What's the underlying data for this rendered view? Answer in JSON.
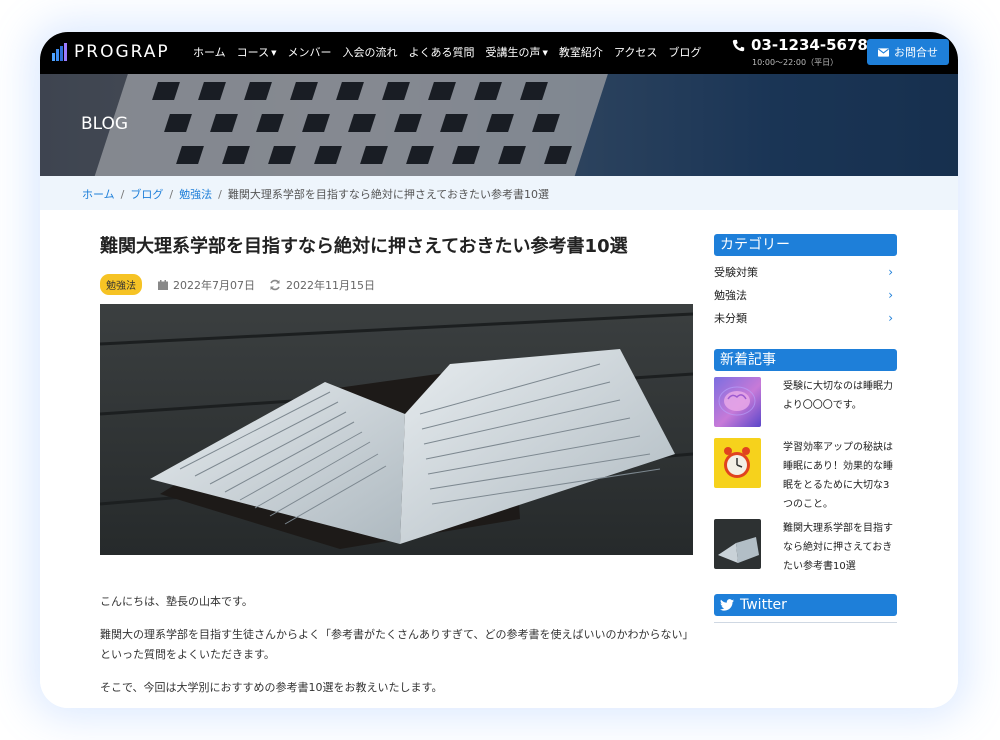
{
  "header": {
    "logo_text": "PROGRAP",
    "nav": [
      {
        "label": "ホーム",
        "has_caret": false
      },
      {
        "label": "コース",
        "has_caret": true
      },
      {
        "label": "メンバー",
        "has_caret": false
      },
      {
        "label": "入会の流れ",
        "has_caret": false
      },
      {
        "label": "よくある質問",
        "has_caret": false
      },
      {
        "label": "受講生の声",
        "has_caret": true
      },
      {
        "label": "教室紹介",
        "has_caret": false
      },
      {
        "label": "アクセス",
        "has_caret": false
      },
      {
        "label": "ブログ",
        "has_caret": false
      }
    ],
    "phone": "03-1234-5678",
    "hours": "10:00～22:00（平日）",
    "contact_label": "お問合せ"
  },
  "hero": {
    "title": "BLOG"
  },
  "breadcrumb": {
    "home": "ホーム",
    "blog": "ブログ",
    "category": "勉強法",
    "current": "難関大理系学部を目指すなら絶対に押さえておきたい参考書10選",
    "sep": "/"
  },
  "article": {
    "title": "難関大理系学部を目指すなら絶対に押さえておきたい参考書10選",
    "category_badge": "勉強法",
    "published": "2022年7月07日",
    "updated": "2022年11月15日",
    "paragraphs": [
      "こんにちは、塾長の山本です。",
      "難関大の理系学部を目指す生徒さんからよく「参考書がたくさんありすぎて、どの参考書を使えばいいのかわからない」といった質問をよくいただきます。",
      "そこで、今回は大学別におすすめの参考書10選をお教えいたします。"
    ]
  },
  "sidebar": {
    "category_heading": "カテゴリー",
    "categories": [
      "受験対策",
      "勉強法",
      "未分類"
    ],
    "recent_heading": "新着記事",
    "recent_posts": [
      {
        "title": "受験に大切なのは睡眠力より〇〇〇です。",
        "thumb": "brain-image"
      },
      {
        "title": "学習効率アップの秘訣は睡眠にあり！効果的な睡眠をとるために大切な3つのこと。",
        "thumb": "alarm-clock-image"
      },
      {
        "title": "難関大理系学部を目指すなら絶対に押さえておきたい参考書10選",
        "thumb": "book-image"
      }
    ],
    "twitter_heading": "Twitter"
  },
  "colors": {
    "accent": "#1e7fd9",
    "badge": "#f6c324",
    "header_bg": "#000000",
    "breadcrumb_bg": "#eef5fc"
  }
}
